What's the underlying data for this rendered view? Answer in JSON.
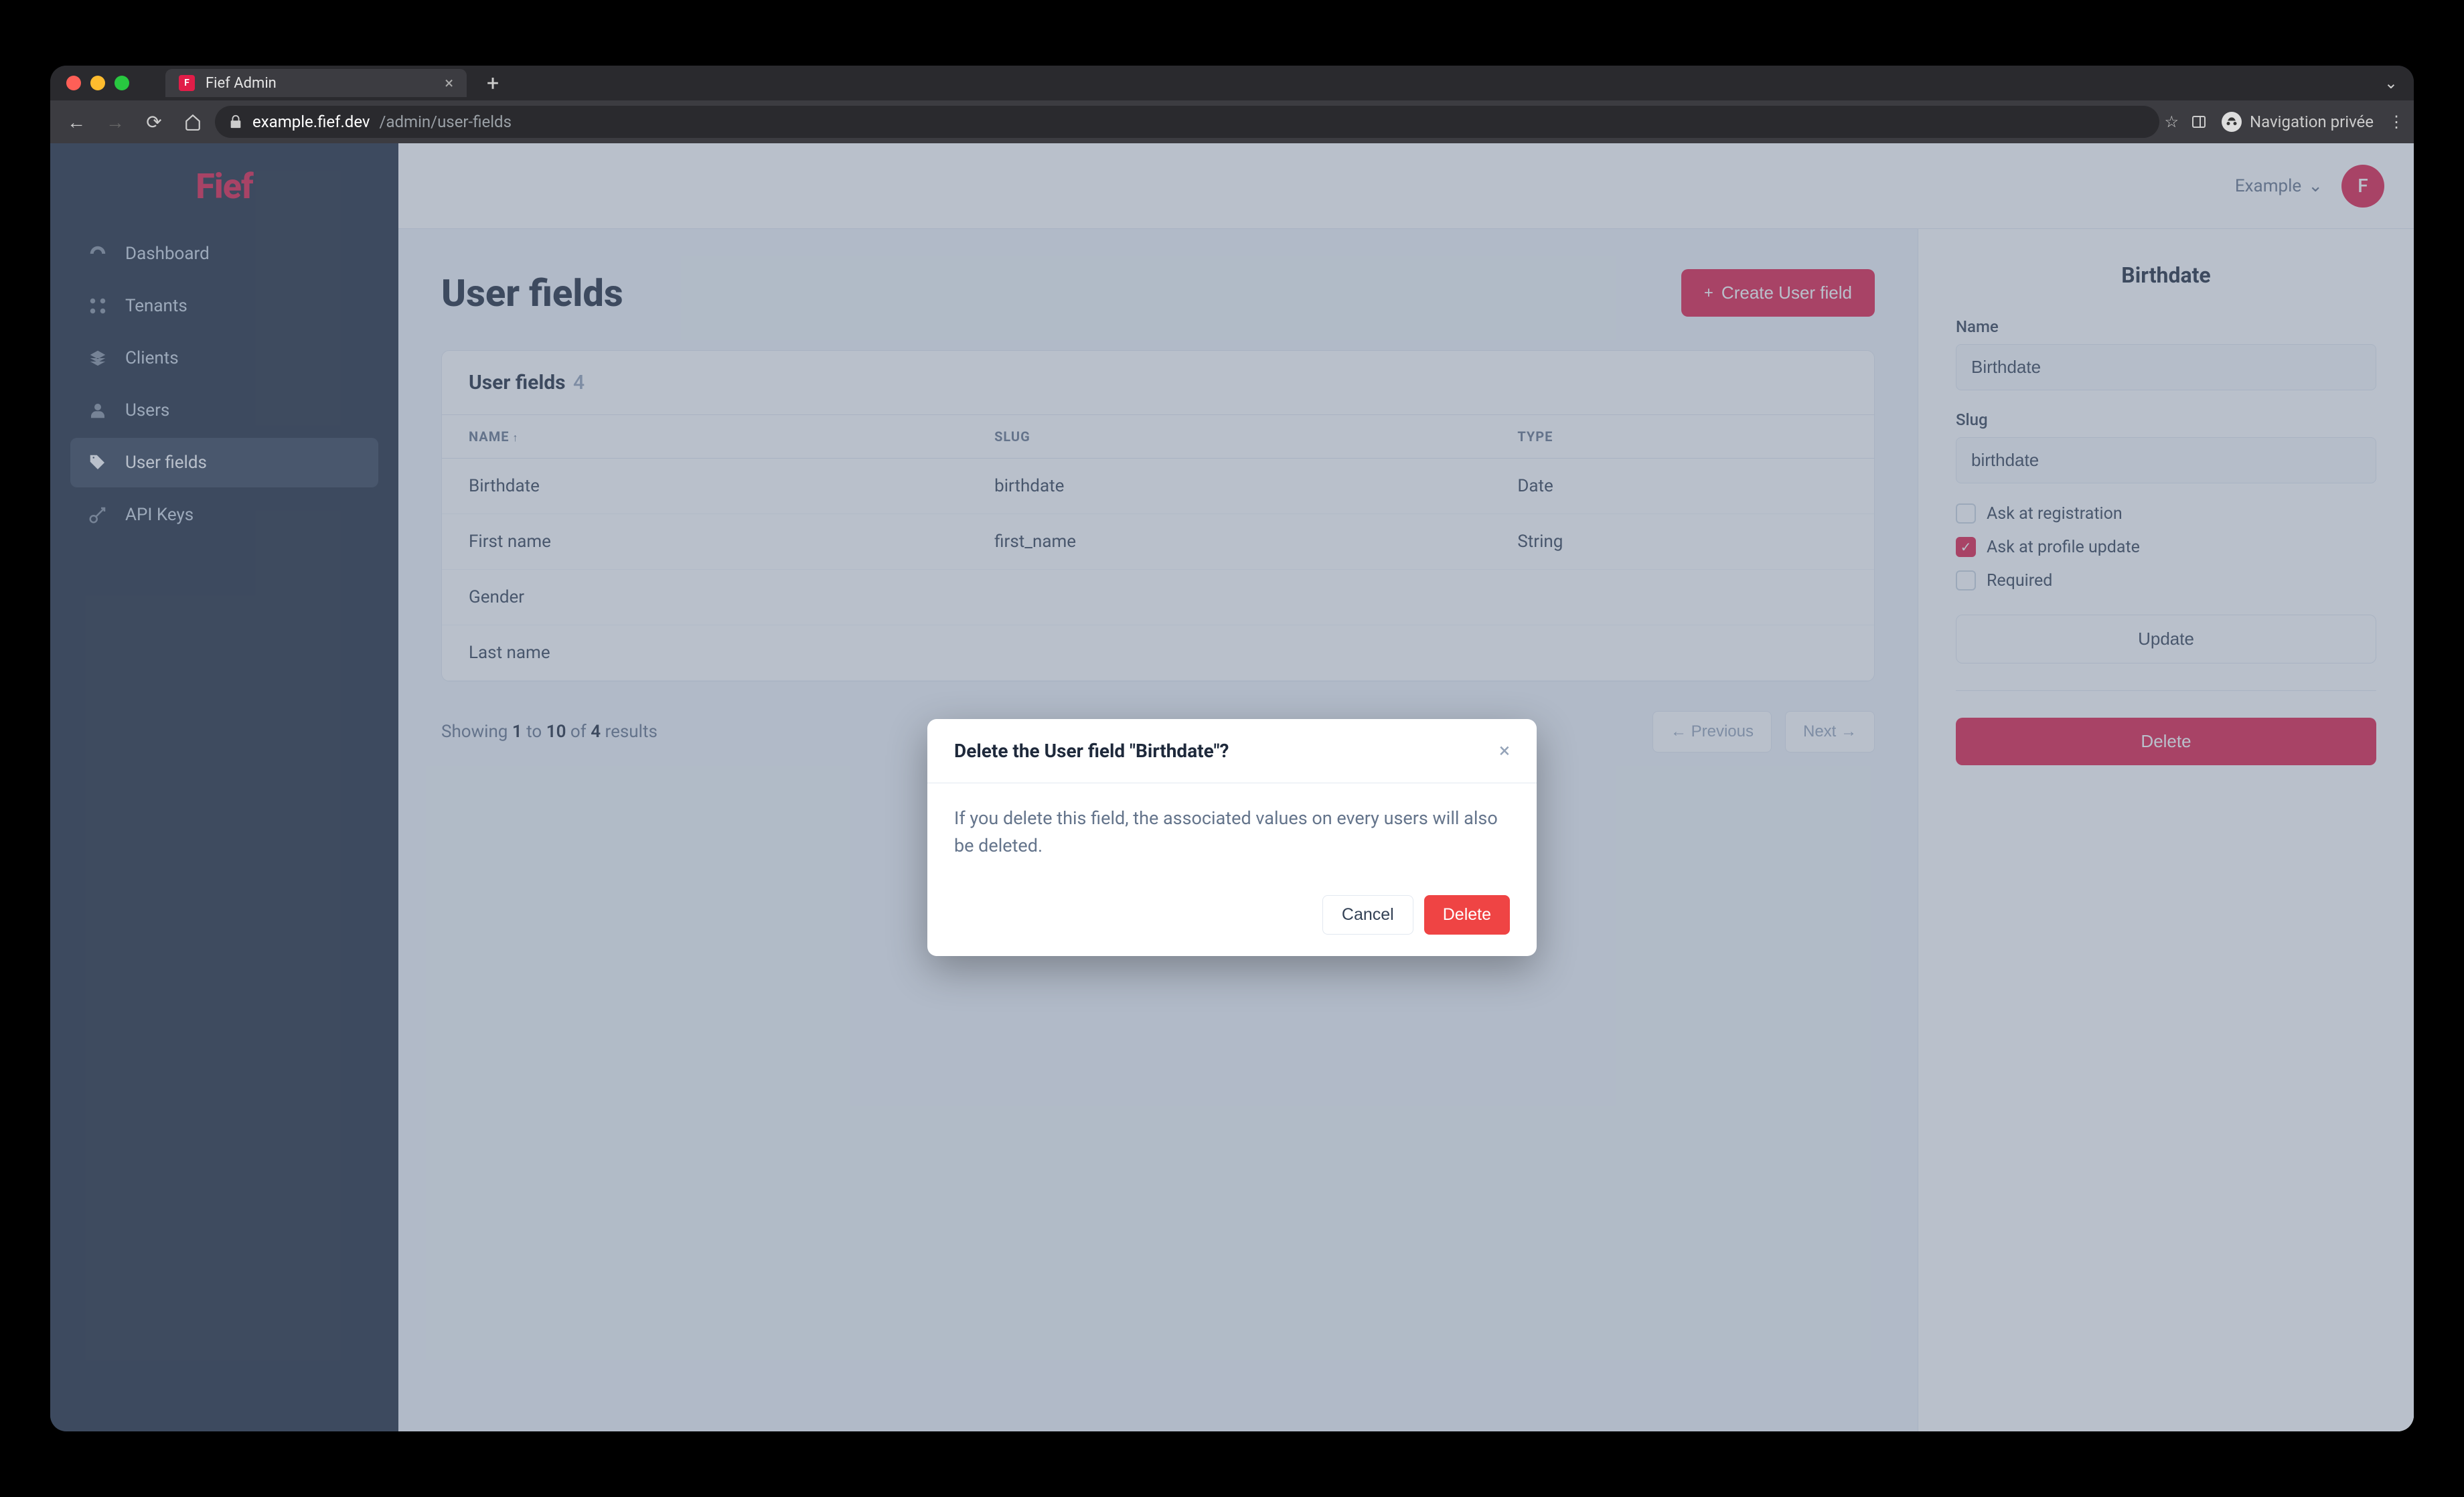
{
  "browser": {
    "tab_title": "Fief Admin",
    "url_domain": "example.fief.dev",
    "url_path": "/admin/user-fields",
    "incognito_label": "Navigation privée"
  },
  "brand": {
    "logo": "Fief"
  },
  "sidebar": {
    "items": [
      {
        "label": "Dashboard"
      },
      {
        "label": "Tenants"
      },
      {
        "label": "Clients"
      },
      {
        "label": "Users"
      },
      {
        "label": "User fields"
      },
      {
        "label": "API Keys"
      }
    ]
  },
  "topbar": {
    "workspace": "Example",
    "avatar_letter": "F"
  },
  "page": {
    "title": "User fields",
    "create_button": "Create User field",
    "card_title": "User fields",
    "count": "4",
    "columns": {
      "name": "Name",
      "slug": "Slug",
      "type": "Type"
    },
    "rows": [
      {
        "name": "Birthdate",
        "slug": "birthdate",
        "type": "Date"
      },
      {
        "name": "First name",
        "slug": "first_name",
        "type": "String"
      },
      {
        "name": "Gender",
        "slug": "",
        "type": ""
      },
      {
        "name": "Last name",
        "slug": "",
        "type": ""
      }
    ],
    "pager": {
      "showing": "Showing",
      "from": "1",
      "to_word": "to",
      "to": "10",
      "of_word": "of",
      "total": "4",
      "results": "results",
      "prev": "← Previous",
      "next": "Next →"
    }
  },
  "detail": {
    "title": "Birthdate",
    "name_label": "Name",
    "name_value": "Birthdate",
    "slug_label": "Slug",
    "slug_value": "birthdate",
    "ask_registration": "Ask at registration",
    "ask_profile_update": "Ask at profile update",
    "required": "Required",
    "update_button": "Update",
    "delete_button": "Delete"
  },
  "modal": {
    "title": "Delete the User field \"Birthdate\"?",
    "body": "If you delete this field, the associated values on every users will also be deleted.",
    "cancel": "Cancel",
    "delete": "Delete"
  }
}
